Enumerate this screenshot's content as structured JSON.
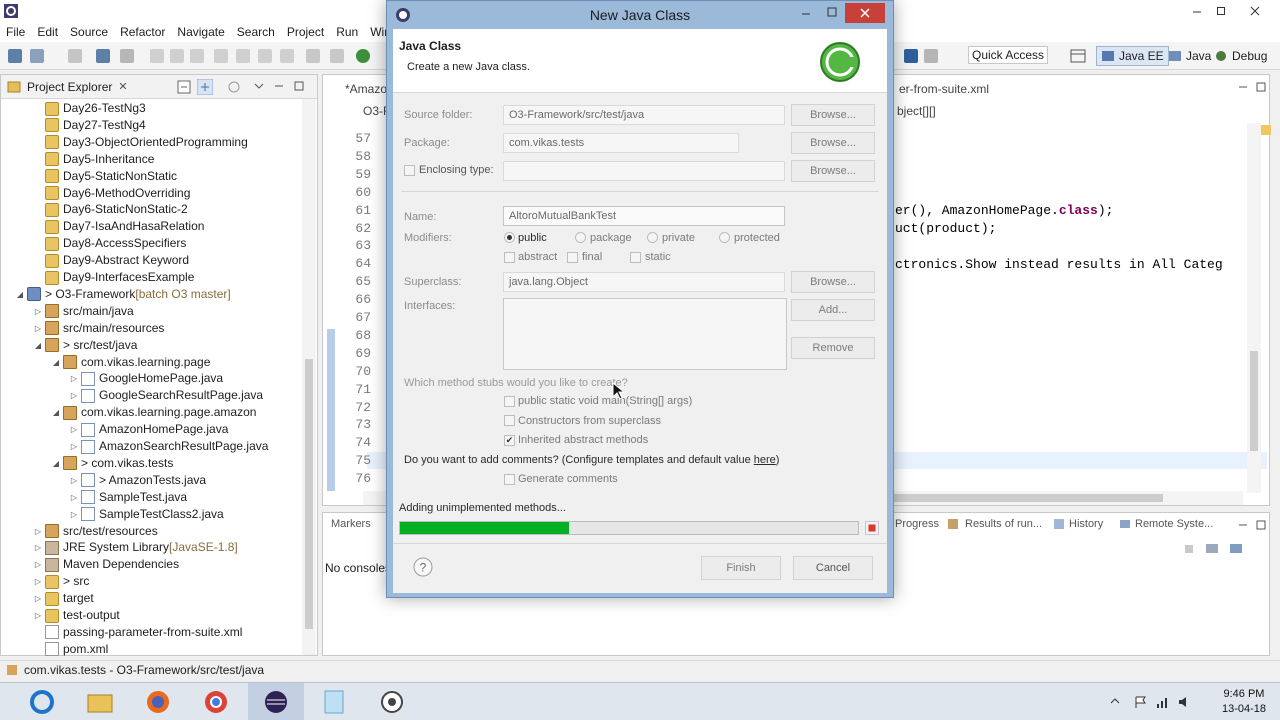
{
  "ide": {
    "menu": [
      "File",
      "Edit",
      "Source",
      "Refactor",
      "Navigate",
      "Search",
      "Project",
      "Run",
      "Windo"
    ],
    "quick_access": "Quick Access",
    "perspectives": [
      "Java EE",
      "Java",
      "Debug"
    ],
    "status_text": "com.vikas.tests - O3-Framework/src/test/java"
  },
  "explorer": {
    "title": "Project Explorer",
    "items": [
      {
        "label": "Day26-TestNg3",
        "icon": "folder",
        "indent": 1
      },
      {
        "label": "Day27-TestNg4",
        "icon": "folder",
        "indent": 1
      },
      {
        "label": "Day3-ObjectOrientedProgramming",
        "icon": "folder",
        "indent": 1
      },
      {
        "label": "Day5-Inheritance",
        "icon": "folder",
        "indent": 1
      },
      {
        "label": "Day5-StaticNonStatic",
        "icon": "folder",
        "indent": 1
      },
      {
        "label": "Day6-MethodOverriding",
        "icon": "folder",
        "indent": 1
      },
      {
        "label": "Day6-StaticNonStatic-2",
        "icon": "folder",
        "indent": 1
      },
      {
        "label": "Day7-IsaAndHasaRelation",
        "icon": "folder",
        "indent": 1
      },
      {
        "label": "Day8-AccessSpecifiers",
        "icon": "folder",
        "indent": 1
      },
      {
        "label": "Day9-Abstract Keyword",
        "icon": "folder",
        "indent": 1
      },
      {
        "label": "Day9-InterfacesExample",
        "icon": "folder",
        "indent": 1
      },
      {
        "label": "> O3-Framework",
        "deco": " [batch O3 master]",
        "icon": "proj",
        "indent": 0,
        "twisty": "open"
      },
      {
        "label": "src/main/java",
        "icon": "pkg",
        "indent": 1,
        "twisty": "closed"
      },
      {
        "label": "src/main/resources",
        "icon": "pkg",
        "indent": 1,
        "twisty": "closed"
      },
      {
        "label": "> src/test/java",
        "icon": "pkg",
        "indent": 1,
        "twisty": "open"
      },
      {
        "label": "com.vikas.learning.page",
        "icon": "pkg",
        "indent": 2,
        "twisty": "open"
      },
      {
        "label": "GoogleHomePage.java",
        "icon": "java",
        "indent": 3,
        "twisty": "closed"
      },
      {
        "label": "GoogleSearchResultPage.java",
        "icon": "java",
        "indent": 3,
        "twisty": "closed"
      },
      {
        "label": "com.vikas.learning.page.amazon",
        "icon": "pkg",
        "indent": 2,
        "twisty": "open"
      },
      {
        "label": "AmazonHomePage.java",
        "icon": "java",
        "indent": 3,
        "twisty": "closed"
      },
      {
        "label": "AmazonSearchResultPage.java",
        "icon": "java",
        "indent": 3,
        "twisty": "closed"
      },
      {
        "label": "> com.vikas.tests",
        "icon": "pkg",
        "indent": 2,
        "twisty": "open"
      },
      {
        "label": "> AmazonTests.java",
        "icon": "java",
        "indent": 3,
        "twisty": "closed"
      },
      {
        "label": "SampleTest.java",
        "icon": "java",
        "indent": 3,
        "twisty": "closed"
      },
      {
        "label": "SampleTestClass2.java",
        "icon": "java",
        "indent": 3,
        "twisty": "closed"
      },
      {
        "label": "src/test/resources",
        "icon": "pkg",
        "indent": 1,
        "twisty": "closed"
      },
      {
        "label": "JRE System Library",
        "deco": " [JavaSE-1.8]",
        "icon": "lib",
        "indent": 1,
        "twisty": "closed"
      },
      {
        "label": "Maven Dependencies",
        "icon": "lib",
        "indent": 1,
        "twisty": "closed"
      },
      {
        "label": "> src",
        "icon": "folder",
        "indent": 1,
        "twisty": "closed"
      },
      {
        "label": "target",
        "icon": "folder",
        "indent": 1,
        "twisty": "closed"
      },
      {
        "label": "test-output",
        "icon": "folder",
        "indent": 1,
        "twisty": "closed"
      },
      {
        "label": "passing-parameter-from-suite.xml",
        "icon": "file",
        "indent": 1
      },
      {
        "label": "pom.xml",
        "icon": "file",
        "indent": 1
      }
    ]
  },
  "editor": {
    "tab_left": "*Amazon",
    "tab_sub": "O3-F",
    "tab_right": "er-from-suite.xml",
    "crumb_right": "bject[][]",
    "line_numbers": [
      "57",
      "58",
      "59",
      "60",
      "61",
      "62",
      "63",
      "64",
      "65",
      "66",
      "67",
      "68",
      "69",
      "70",
      "71",
      "72",
      "73",
      "74",
      "75",
      "76"
    ],
    "code_line_61_a": "er(), AmazonHomePage.",
    "code_line_61_kw": "class",
    "code_line_61_b": ");",
    "code_line_62": "uct(product);",
    "code_line_65": "ctronics.Show instead results in All Categ"
  },
  "bottom": {
    "markers_tab": "Markers",
    "progress_tab": "Progress",
    "results_tab": "Results of run...",
    "history_tab": "History",
    "remote_tab": "Remote Syste...",
    "console_text": "No consoles"
  },
  "dialog": {
    "window_title": "New Java Class",
    "heading": "Java Class",
    "subheading": "Create a new Java class.",
    "source_folder_label": "Source folder:",
    "source_folder_value": "O3-Framework/src/test/java",
    "package_label": "Package:",
    "package_value": "com.vikas.tests",
    "enclosing_label": "Enclosing type:",
    "name_label": "Name:",
    "name_value": "AltoroMutualBankTest",
    "modifiers_label": "Modifiers:",
    "mod_public": "public",
    "mod_package": "package",
    "mod_private": "private",
    "mod_protected": "protected",
    "mod_abstract": "abstract",
    "mod_final": "final",
    "mod_static": "static",
    "superclass_label": "Superclass:",
    "superclass_value": "java.lang.Object",
    "interfaces_label": "Interfaces:",
    "browse": "Browse...",
    "add": "Add...",
    "remove": "Remove",
    "stubs_question": "Which method stubs would you like to create?",
    "stub_main": "public static void main(String[] args)",
    "stub_constructors": "Constructors from superclass",
    "stub_inherited": "Inherited abstract methods",
    "comments_question": "Do you want to add comments? (Configure templates and default value ",
    "comments_link": "here",
    "comments_close": ")",
    "generate_comments": "Generate comments",
    "progress_text": "Adding unimplemented methods...",
    "progress_fraction": 0.37,
    "finish": "Finish",
    "cancel": "Cancel"
  },
  "taskbar": {
    "time": "9:46 PM",
    "date": "13-04-18"
  }
}
